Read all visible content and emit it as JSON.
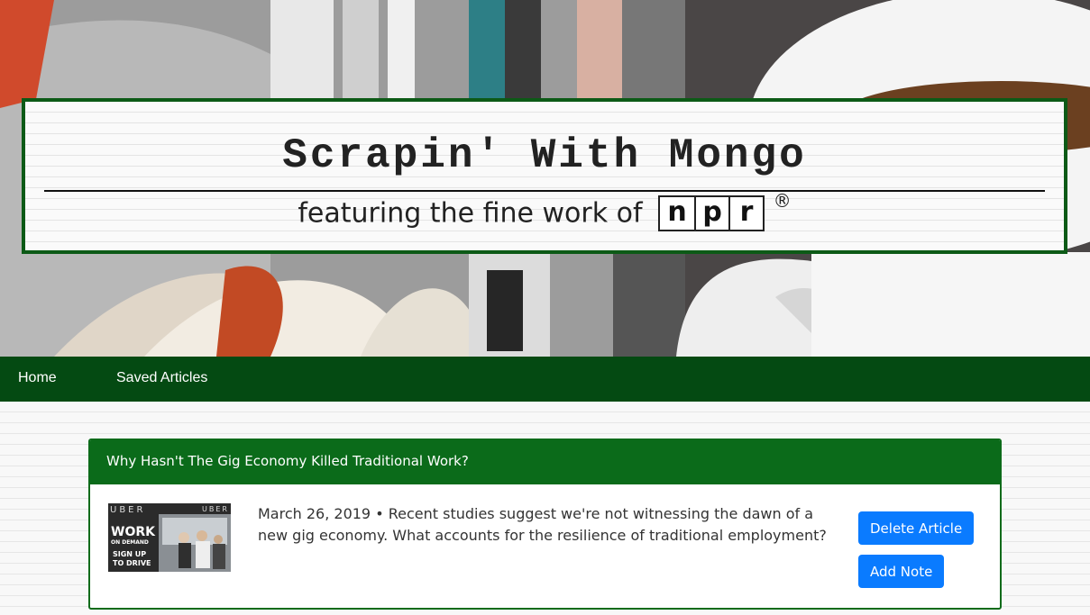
{
  "header": {
    "title": "Scrapin' With Mongo",
    "subtitle_prefix": "featuring the fine work of",
    "logo_letters": [
      "n",
      "p",
      "r"
    ],
    "registered_mark": "®"
  },
  "nav": {
    "home": "Home",
    "saved": "Saved Articles"
  },
  "articles": [
    {
      "title": "Why Hasn't The Gig Economy Killed Traditional Work?",
      "summary": "March 26, 2019 • Recent studies suggest we're not witnessing the dawn of a new gig economy. What accounts for the resilience of traditional employment?",
      "thumbnail_text": {
        "brand": "UBER",
        "line1": "WORK",
        "line2": "ON DEMAND",
        "line3": "SIGN UP",
        "line4": "TO DRIVE"
      },
      "delete_label": "Delete Article",
      "note_label": "Add Note"
    }
  ],
  "colors": {
    "nav_bg": "#044a12",
    "card_header": "#0b6b1a",
    "button": "#0a7bff"
  }
}
